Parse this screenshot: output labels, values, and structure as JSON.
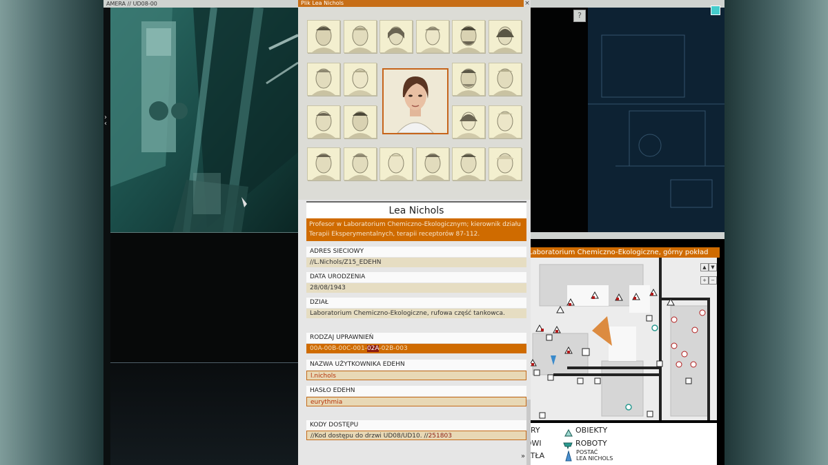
{
  "camera": {
    "title": "AMERA // UD08-00"
  },
  "dossier": {
    "window_title": "Plik Lea Nichols",
    "close_glyph": "×",
    "name": "Lea Nichols",
    "description": "Profesor w Laboratorium Chemiczno-Ekologicznym; kierownik działu Terapii Eksperymentalnych, terapii receptorów 87-112.",
    "fields": {
      "network": {
        "label": "ADRES SIECIOWY",
        "value": "//L.Nichols/Z15_EDEHN"
      },
      "birth": {
        "label": "DATA URODZENIA",
        "value": "28/08/1943"
      },
      "dept": {
        "label": "DZIAŁ",
        "value": "Laboratorium Chemiczno-Ekologiczne, rufowa część tankowca."
      },
      "perm": {
        "label": "RODZAJ UPRAWNIEŃ",
        "value_pre": "00A-00B-00C-001-",
        "value_hl": "02A",
        "value_post": "-02B-003"
      },
      "user": {
        "label": "NAZWA UŻYTKOWNIKA EDEHN",
        "value": "l.nichols"
      },
      "pass": {
        "label": "HASŁO EDEHN",
        "value": "eurythmia"
      },
      "codes": {
        "label": "KODY DOSTĘPU",
        "value_pre": "//Kod dostępu do drzwi UD08/UD10. //",
        "value_hl": "251803"
      }
    }
  },
  "help": {
    "glyph": "?"
  },
  "map": {
    "title": "Laboratorium Chemiczno-Ekologiczne, górny pokład",
    "zoom_up": "▲",
    "zoom_down": "▼",
    "zoom_in": "+",
    "zoom_out": "−",
    "legend": {
      "item1": "ERY",
      "item2": "DWI",
      "item3": "ATŁA",
      "objects": "OBIEKTY",
      "robots": "ROBOTY",
      "character_line1": "POSTAĆ",
      "character_line2": "LEA NICHOLS"
    },
    "scroll_down": "»"
  },
  "colors": {
    "accent": "#cf6b00",
    "highlight": "#8a1a10",
    "marker_red": "#b01818",
    "marker_teal": "#2a9a90"
  }
}
